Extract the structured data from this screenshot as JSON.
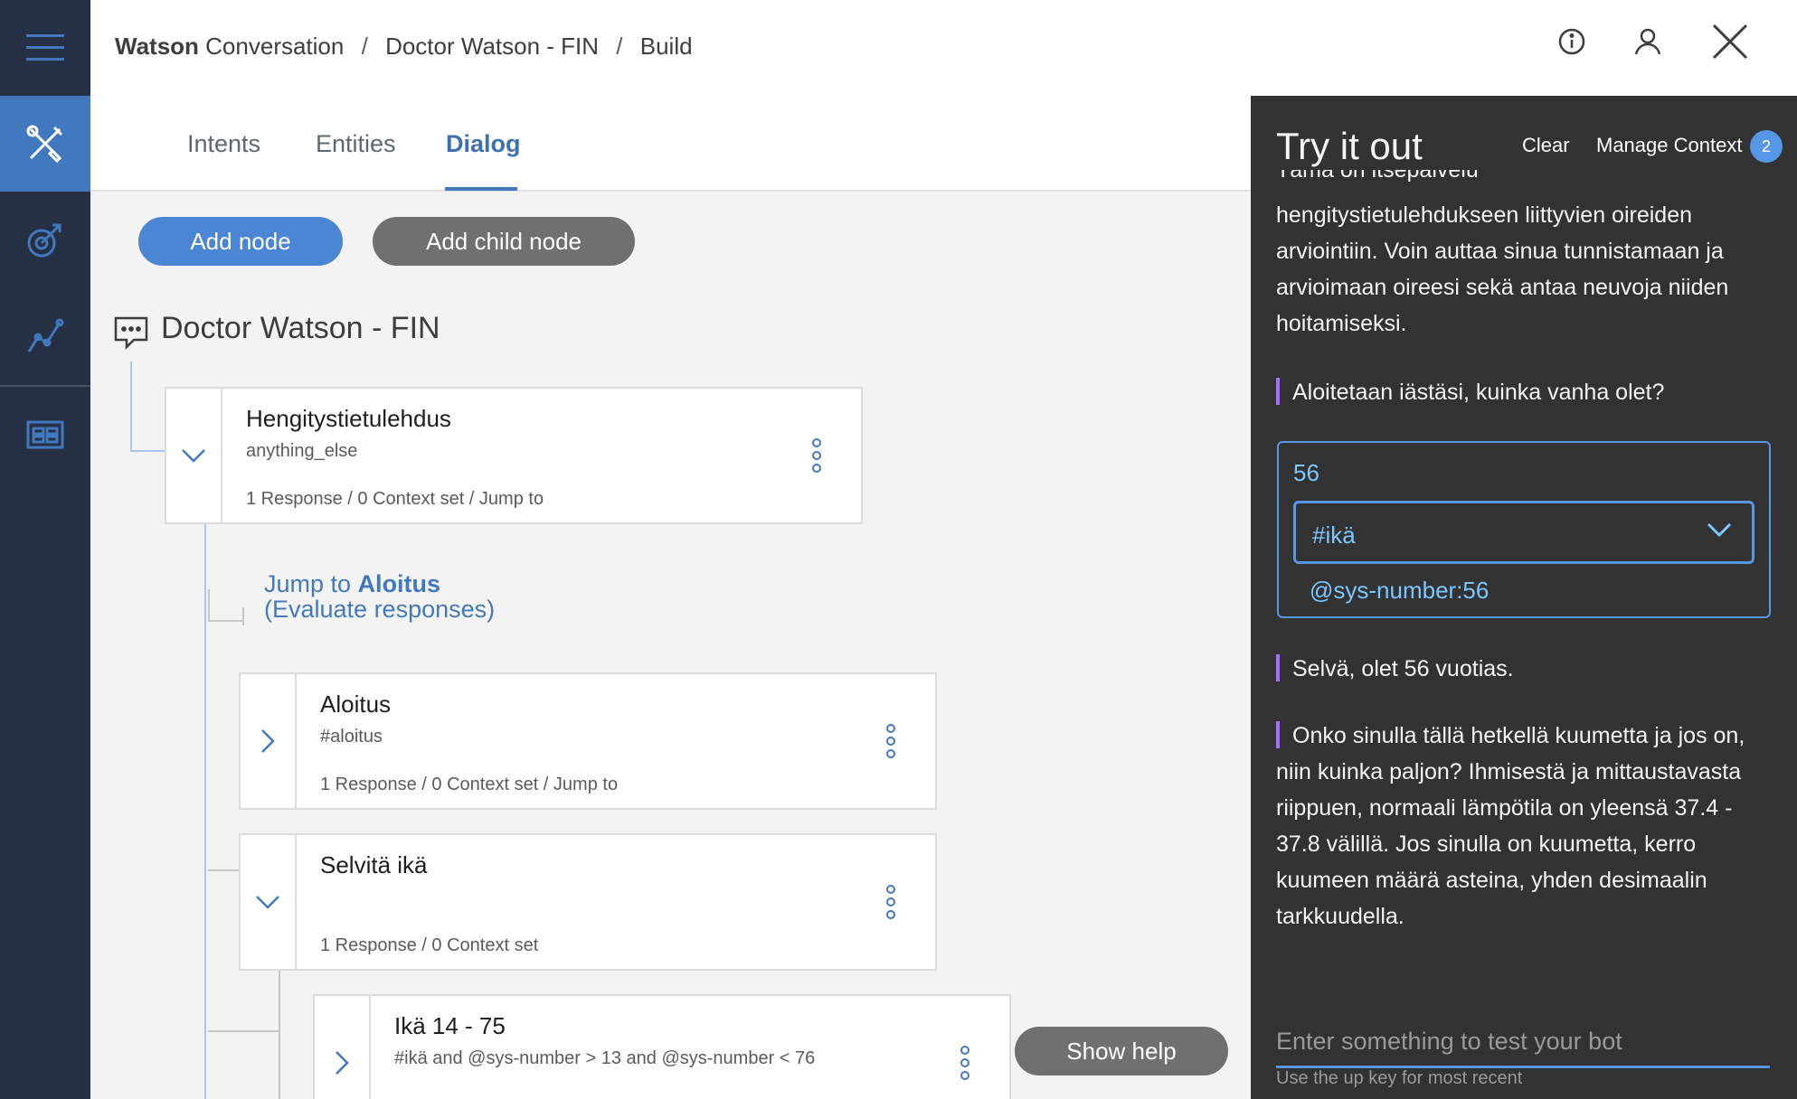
{
  "breadcrumb": {
    "brand_bold": "Watson",
    "brand_rest": "Conversation",
    "workspace": "Doctor Watson - FIN",
    "page": "Build",
    "separator": "/"
  },
  "tabs": [
    {
      "label": "Intents",
      "active": false
    },
    {
      "label": "Entities",
      "active": false
    },
    {
      "label": "Dialog",
      "active": true
    }
  ],
  "toolbar": {
    "add_node": "Add node",
    "add_child_node": "Add child node"
  },
  "workspace_title": "Doctor Watson - FIN",
  "nodes": [
    {
      "title": "Hengitystietulehdus",
      "condition": "anything_else",
      "meta": "1 Response / 0 Context set / Jump to",
      "expanded": true
    },
    {
      "title": "Aloitus",
      "condition": "#aloitus",
      "meta": "1 Response / 0 Context set / Jump to",
      "expanded": false
    },
    {
      "title": "Selvitä ikä",
      "condition": "",
      "meta": "1 Response / 0 Context set",
      "expanded": true
    },
    {
      "title": "Ikä 14 - 75",
      "condition": "#ikä and @sys-number > 13 and @sys-number < 76",
      "meta": "",
      "expanded": false
    }
  ],
  "jump": {
    "prefix": "Jump to",
    "target": "Aloitus",
    "note": "(Evaluate responses)"
  },
  "show_help": "Show help",
  "try_it_out": {
    "title": "Try it out",
    "clear": "Clear",
    "manage_context": "Manage Context",
    "context_count": "2",
    "clipped_message": "Tämä on itsepalvelu",
    "message_1": "hengitystietulehdukseen liittyvien oireiden arviointiin. Voin auttaa sinua tunnistamaan ja arvioimaan oireesi sekä antaa neuvoja niiden hoitamiseksi.",
    "message_2": "Aloitetaan iästäsi, kuinka vanha olet?",
    "user_input": "56",
    "intent": "#ikä",
    "entity": "@sys-number:56",
    "message_3": "Selvä, olet 56 vuotias.",
    "message_4": "Onko sinulla tällä hetkellä kuumetta ja jos on, niin kuinka paljon? Ihmisestä ja mittaustavasta riippuen, normaali lämpötila on yleensä 37.4 - 37.8 välillä. Jos sinulla on kuumetta, kerro kuumeen määrä asteina, yhden desimaalin tarkkuudella.",
    "input_placeholder": "Enter something to test your bot",
    "input_hint": "Use the up key for most recent"
  },
  "colors": {
    "rail": "#253044",
    "accent": "#4178be",
    "panel": "#323232",
    "user_text": "#7cc7ff",
    "bot_bar": "#a56eff"
  }
}
